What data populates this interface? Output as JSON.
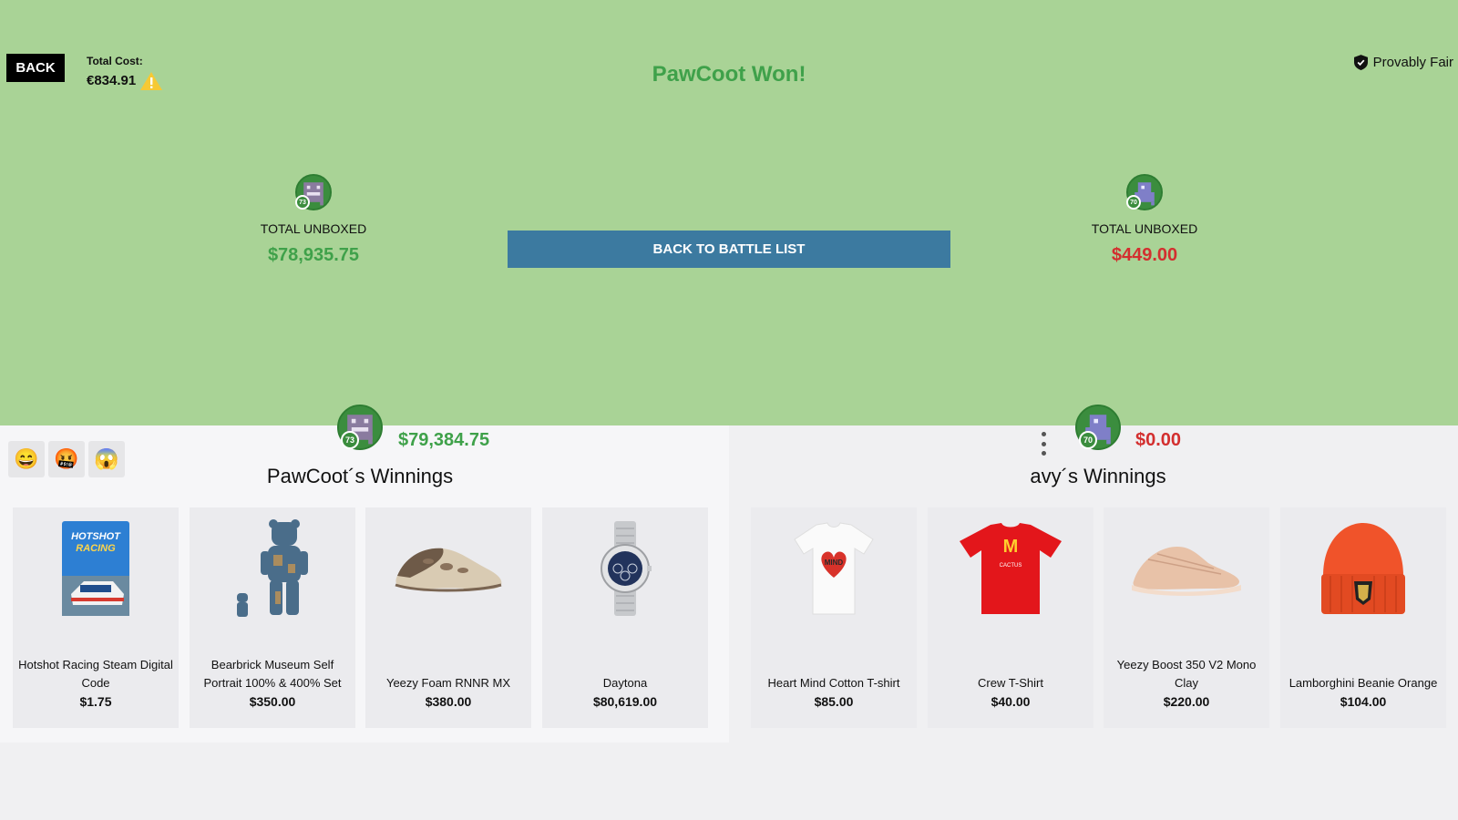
{
  "header": {
    "back_label": "BACK",
    "total_cost_label": "Total Cost:",
    "total_cost_value": "€834.91",
    "winner_text": "PawCoot Won!",
    "provably_fair_label": "Provably Fair",
    "back_to_battle_list_label": "BACK TO BATTLE LIST"
  },
  "players": [
    {
      "name": "PawCoot",
      "level": "73",
      "total_unboxed_label": "TOTAL UNBOXED",
      "total_unboxed_value": "$78,935.75",
      "winnings_amount": "$79,384.75",
      "winnings_title": "PawCoot´s Winnings",
      "status_color": "#3fa14a",
      "items": [
        {
          "name": "Hotshot Racing Steam Digital Code",
          "price": "$1.75",
          "image": "hotshot-racing-cover"
        },
        {
          "name": "Bearbrick Museum Self Portrait 100% & 400% Set",
          "price": "$350.00",
          "image": "bearbrick-figure"
        },
        {
          "name": "Yeezy Foam RNNR MX",
          "price": "$380.00",
          "image": "foam-runner-shoe"
        },
        {
          "name": "Daytona",
          "price": "$80,619.00",
          "image": "rolex-watch"
        }
      ]
    },
    {
      "name": "avy",
      "level": "70",
      "total_unboxed_label": "TOTAL UNBOXED",
      "total_unboxed_value": "$449.00",
      "winnings_amount": "$0.00",
      "winnings_title": "avy´s Winnings",
      "status_color": "#d32f2f",
      "items": [
        {
          "name": "Heart Mind Cotton T-shirt",
          "price": "$85.00",
          "image": "white-tshirt"
        },
        {
          "name": "Crew T-Shirt",
          "price": "$40.00",
          "image": "red-tshirt"
        },
        {
          "name": "Yeezy Boost 350 V2 Mono Clay",
          "price": "$220.00",
          "image": "yeezy-boost-shoe"
        },
        {
          "name": "Lamborghini Beanie Orange",
          "price": "$104.00",
          "image": "orange-beanie"
        }
      ]
    }
  ],
  "reactions": [
    {
      "emoji": "😄",
      "name": "grin-emoji"
    },
    {
      "emoji": "🤬",
      "name": "angry-emoji"
    },
    {
      "emoji": "😱",
      "name": "scream-emoji"
    }
  ],
  "colors": {
    "top_background": "#a9d396",
    "win_green": "#3fa14a",
    "lose_red": "#d32f2f",
    "button_blue": "#3c7aa0"
  }
}
